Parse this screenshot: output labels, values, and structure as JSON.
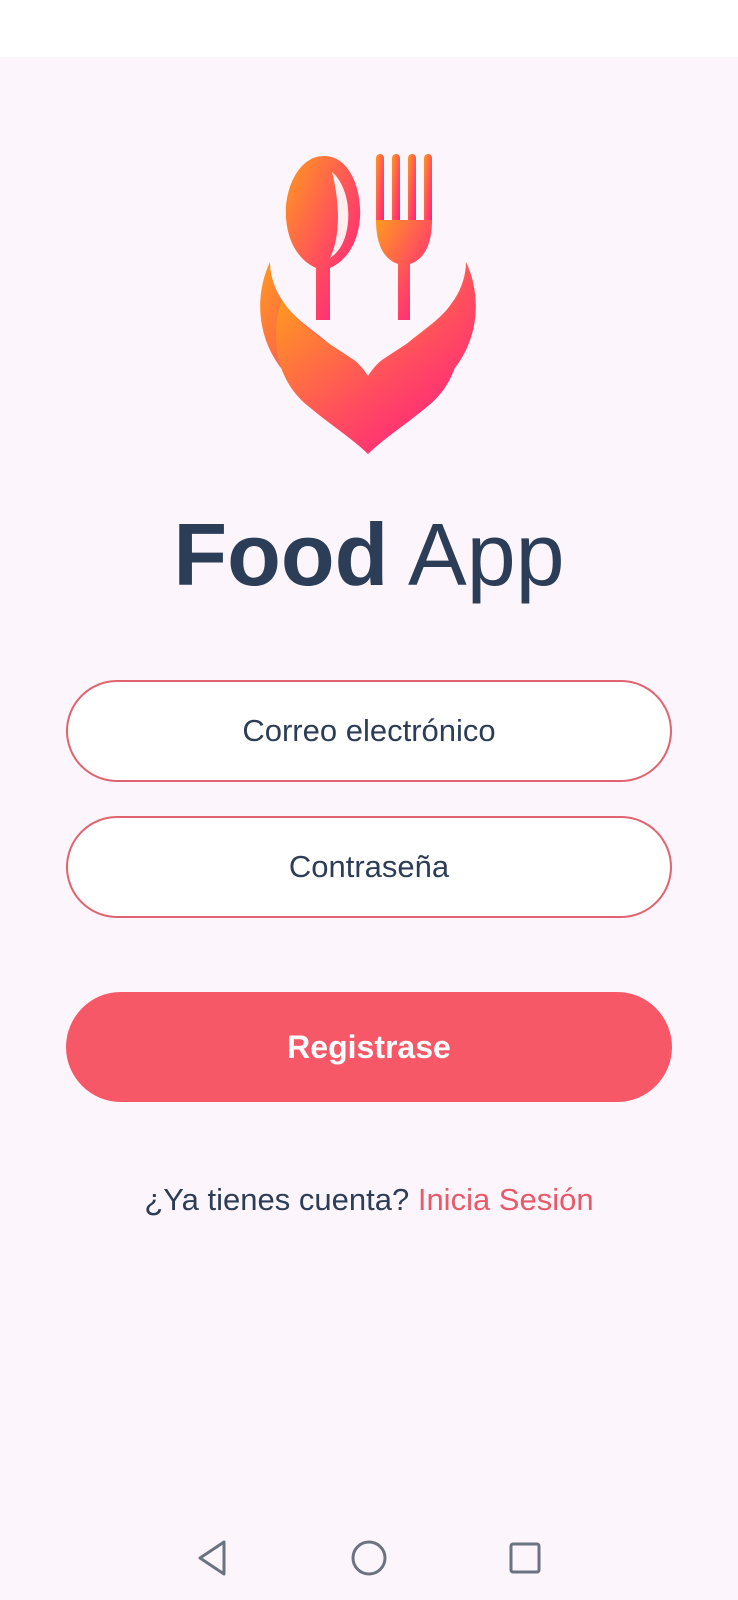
{
  "app": {
    "title_bold": "Food",
    "title_light": "App"
  },
  "logo": {
    "icon": "spoon-fork-hands-logo",
    "gradient_start": "#ff9a1f",
    "gradient_end": "#ff1a86"
  },
  "form": {
    "email_placeholder": "Correo electrónico",
    "email_value": "",
    "password_placeholder": "Contraseña",
    "password_value": "",
    "register_label": "Registrase"
  },
  "login_prompt": {
    "text": "¿Ya tienes cuenta?",
    "link_label": "Inicia Sesión"
  },
  "nav": {
    "back_icon": "triangle-back-icon",
    "home_icon": "circle-home-icon",
    "recents_icon": "square-recents-icon"
  },
  "colors": {
    "background": "#fdf5fc",
    "accent": "#f75868",
    "text": "#2c3e57",
    "field_border": "#e0636f"
  }
}
